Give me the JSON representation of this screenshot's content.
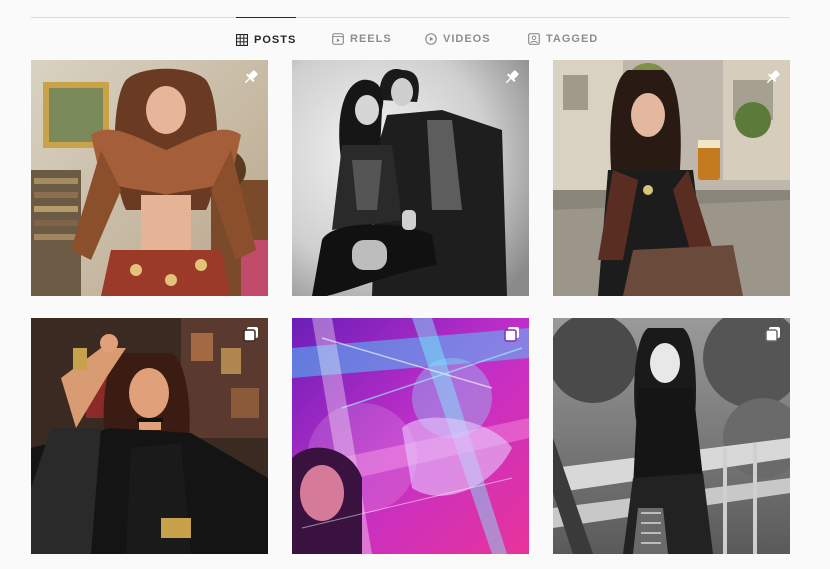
{
  "tabs": [
    {
      "label": "POSTS",
      "icon": "grid-icon",
      "active": true
    },
    {
      "label": "REELS",
      "icon": "reels-icon",
      "active": false
    },
    {
      "label": "VIDEOS",
      "icon": "video-icon",
      "active": false
    },
    {
      "label": "TAGGED",
      "icon": "tagged-icon",
      "active": false
    }
  ],
  "posts": [
    {
      "badge": "pin-icon",
      "scene": "woman in patterned crop top and skirt in vintage room with records"
    },
    {
      "badge": "pin-icon",
      "scene": "black and white couple portrait"
    },
    {
      "badge": "pin-icon",
      "scene": "woman with beer at street cafe"
    },
    {
      "badge": "carousel-icon",
      "scene": "woman in sheer black top with gold cuffs"
    },
    {
      "badge": "carousel-icon",
      "scene": "neon pink and blue light portrait"
    },
    {
      "badge": "carousel-icon",
      "scene": "black and white woman on bridge"
    }
  ],
  "colors": {
    "active_tab": "#262626",
    "inactive_tab": "#8e8e8e",
    "divider": "#dbdbdb",
    "background": "#fafafa"
  }
}
